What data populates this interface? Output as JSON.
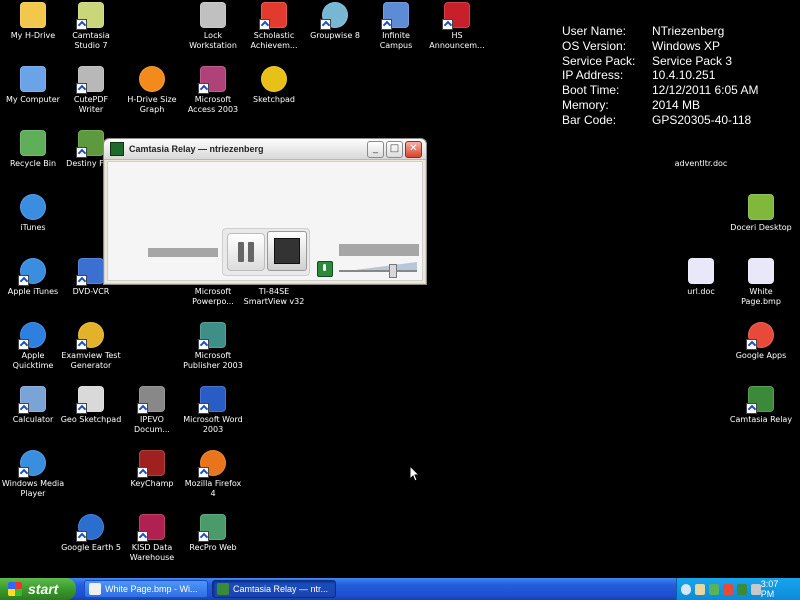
{
  "desktop": {
    "icons": [
      {
        "label": "My H-Drive",
        "icon": "folder-icon",
        "color": "#f1c84b"
      },
      {
        "label": "Camtasia\nStudio 7",
        "icon": "camtasia-studio-icon",
        "color": "#c9d67a"
      },
      {
        "label": "Lock\nWorkstation",
        "icon": "lock-keys-icon",
        "color": "#c0c0c0"
      },
      {
        "label": "Scholastic\nAchievem...",
        "icon": "scholastic-icon",
        "color": "#e23b2e"
      },
      {
        "label": "Groupwise 8",
        "icon": "groupwise-icon",
        "color": "#78b7d4"
      },
      {
        "label": "Infinite\nCampus",
        "icon": "infinite-campus-icon",
        "color": "#5d8cd6"
      },
      {
        "label": "HS\nAnnouncem...",
        "icon": "announcement-icon",
        "color": "#c8202b"
      },
      {
        "label": "My Computer",
        "icon": "computer-icon",
        "color": "#6aa3e8"
      },
      {
        "label": "CutePDF\nWriter",
        "icon": "printer-icon",
        "color": "#b8b8b8"
      },
      {
        "label": "H-Drive Size\nGraph",
        "icon": "pie-graph-icon",
        "color": "#f28a1c"
      },
      {
        "label": "Microsoft\nAccess 2003",
        "icon": "access-icon",
        "color": "#b0427a"
      },
      {
        "label": "Sketchpad",
        "icon": "sketchpad-icon",
        "color": "#e8c018"
      },
      {
        "label": "Recycle Bin",
        "icon": "recycle-bin-icon",
        "color": "#5fae5a"
      },
      {
        "label": "Destiny Fo...",
        "icon": "destiny-icon",
        "color": "#5d9a3e"
      },
      {
        "label": "iTunes",
        "icon": "itunes-icon",
        "color": "#3b8de0"
      },
      {
        "label": "Apple iTunes",
        "icon": "itunes-icon",
        "color": "#3b8de0"
      },
      {
        "label": "DVD-VCR",
        "icon": "dvd-vcr-icon",
        "color": "#3b6fd0"
      },
      {
        "label": "Microsoft\nPowerpo...",
        "icon": "powerpoint-icon",
        "color": "#d06a2a"
      },
      {
        "label": "TI-84SE\nSmartView v32",
        "icon": "calculator-icon",
        "color": "#555555"
      },
      {
        "label": "Apple\nQuicktime",
        "icon": "quicktime-icon",
        "color": "#2d7fe0"
      },
      {
        "label": "Examview Test\nGenerator",
        "icon": "examview-icon",
        "color": "#e3b22a"
      },
      {
        "label": "Microsoft\nPublisher 2003",
        "icon": "publisher-icon",
        "color": "#3f8f88"
      },
      {
        "label": "Calculator",
        "icon": "calculator-icon",
        "color": "#7aa3d6"
      },
      {
        "label": "Geo Sketchpad",
        "icon": "geo-sketchpad-icon",
        "color": "#d9d9d9"
      },
      {
        "label": "IPEVO\nDocum...",
        "icon": "ipevo-icon",
        "color": "#888888"
      },
      {
        "label": "Microsoft Word\n2003",
        "icon": "word-icon",
        "color": "#2a5cc5"
      },
      {
        "label": "Windows Media\nPlayer",
        "icon": "media-player-icon",
        "color": "#3a8ee0"
      },
      {
        "label": "KeyChamp",
        "icon": "keychamp-icon",
        "color": "#a02020"
      },
      {
        "label": "Mozilla Firefox\n4",
        "icon": "firefox-icon",
        "color": "#e8741c"
      },
      {
        "label": "Google Earth 5",
        "icon": "google-earth-icon",
        "color": "#2a6fd0"
      },
      {
        "label": "KISD Data\nWarehouse",
        "icon": "data-warehouse-icon",
        "color": "#b02050"
      },
      {
        "label": "RecPro Web",
        "icon": "recpro-icon",
        "color": "#4a9a6a"
      },
      {
        "label": "adventltr.doc",
        "icon": "document-icon",
        "color": "#e8e8f8"
      },
      {
        "label": "Doceri Desktop",
        "icon": "doceri-icon",
        "color": "#7fb83a"
      },
      {
        "label": "url.doc",
        "icon": "document-icon",
        "color": "#e8e8f8"
      },
      {
        "label": "White\nPage.bmp",
        "icon": "bitmap-icon",
        "color": "#e8e8f8"
      },
      {
        "label": "Google Apps",
        "icon": "google-apps-icon",
        "color": "#e84a3a"
      },
      {
        "label": "Camtasia Relay",
        "icon": "camtasia-relay-icon",
        "color": "#3a8a3a"
      }
    ]
  },
  "sysinfo": {
    "rows": [
      {
        "key": "User Name:",
        "value": "NTriezenberg"
      },
      {
        "key": "OS Version:",
        "value": "Windows XP"
      },
      {
        "key": "Service Pack:",
        "value": "Service Pack 3"
      },
      {
        "key": "IP Address:",
        "value": "10.4.10.251"
      },
      {
        "key": "Boot Time:",
        "value": "12/12/2011 6:05 AM"
      },
      {
        "key": "Memory:",
        "value": "2014 MB"
      },
      {
        "key": "Bar Code:",
        "value": "GPS20305-40-118"
      }
    ]
  },
  "window": {
    "title": "Camtasia Relay — ntriezenberg",
    "minimize": "_",
    "maximize": "□",
    "close": "✕",
    "volume_level": 0.7
  },
  "taskbar": {
    "start_label": "start",
    "tasks": [
      {
        "label": "White Page.bmp - Wi...",
        "icon": "paint-icon",
        "active": false
      },
      {
        "label": "Camtasia Relay — ntr...",
        "icon": "camtasia-relay-icon",
        "active": true
      }
    ],
    "clock": "3:07 PM"
  },
  "colors": {
    "desktop_bg": "#000000",
    "taskbar_blue": "#245edb",
    "start_green": "#3a9b2c",
    "tray_blue": "#0e8ad9"
  }
}
